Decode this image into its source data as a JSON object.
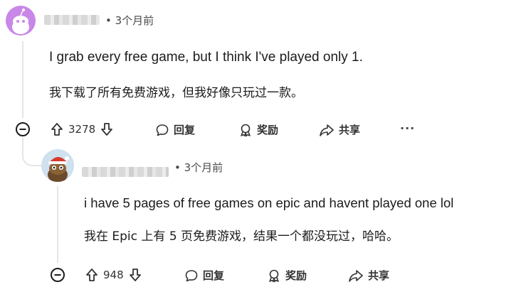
{
  "comment1": {
    "time": "• 3个月前",
    "text_en": "I grab every free game,  but I think I've played only 1.",
    "text_zh": "我下载了所有免费游戏，但我好像只玩过一款。",
    "votes": "3278",
    "reply_label": "回复",
    "award_label": "奖励",
    "share_label": "共享",
    "more_label": "···"
  },
  "comment2": {
    "time": "• 3个月前",
    "text_en": "i have 5 pages of free games on epic and havent played one lol",
    "text_zh": "我在 Epic 上有 5 页免费游戏，结果一个都没玩过，哈哈。",
    "votes": "948",
    "reply_label": "回复",
    "award_label": "奖励",
    "share_label": "共享"
  },
  "colors": {
    "avatar1_bg": "#c987e8",
    "avatar2_bg": "#cfe0ef",
    "meta_text": "#4a4a4a"
  }
}
